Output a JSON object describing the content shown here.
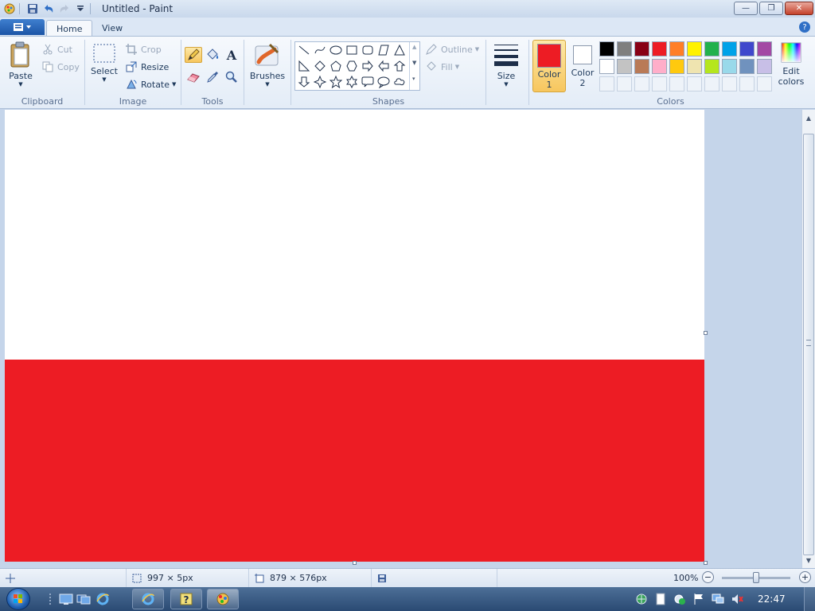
{
  "window": {
    "title": "Untitled - Paint",
    "min_glyph": "—",
    "max_glyph": "❐",
    "close_glyph": "✕"
  },
  "tabs": [
    {
      "label": "Home",
      "active": true
    },
    {
      "label": "View",
      "active": false
    }
  ],
  "help_glyph": "?",
  "ribbon": {
    "clipboard": {
      "label": "Clipboard",
      "paste": "Paste",
      "cut": "Cut",
      "copy": "Copy"
    },
    "image": {
      "label": "Image",
      "select": "Select",
      "crop": "Crop",
      "resize": "Resize",
      "rotate": "Rotate"
    },
    "tools": {
      "label": "Tools",
      "text_glyph": "A"
    },
    "brushes": {
      "label": "Brushes"
    },
    "shapes": {
      "label": "Shapes",
      "outline": "Outline",
      "fill": "Fill"
    },
    "size": {
      "label": "Size"
    },
    "colors": {
      "label": "Colors",
      "color1_label": "Color",
      "color1_num": "1",
      "color2_label": "Color",
      "color2_num": "2",
      "edit_label": "Edit",
      "edit_label2": "colors",
      "color1_value": "#ed1c24",
      "color2_value": "#ffffff",
      "palette_row1": [
        "#000000",
        "#7f7f7f",
        "#880015",
        "#ed1c24",
        "#ff7f27",
        "#fff200",
        "#22b14c",
        "#00a2e8",
        "#3f48cc",
        "#a349a4"
      ],
      "palette_row2": [
        "#ffffff",
        "#c3c3c3",
        "#b97a57",
        "#ffaec9",
        "#ffc90e",
        "#efe4b0",
        "#b5e61d",
        "#99d9ea",
        "#7092be",
        "#c8bfe7"
      ]
    }
  },
  "canvas": {
    "background": "#ffffff",
    "stripe_color": "#ed1c24"
  },
  "status": {
    "cursor_position": "997 × 5px",
    "canvas_size": "879 × 576px",
    "zoom": "100%",
    "zoom_out_glyph": "−",
    "zoom_in_glyph": "+",
    "zoom_level": 0.5
  },
  "taskbar": {
    "clock": "22:47"
  }
}
